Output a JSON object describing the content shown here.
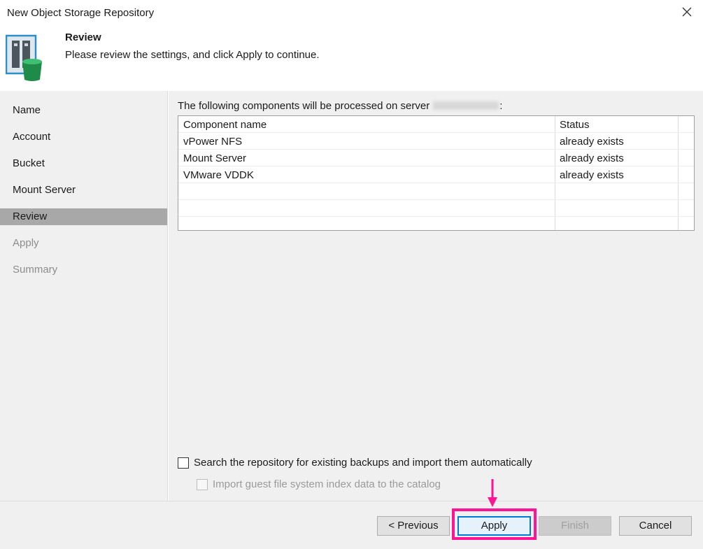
{
  "window": {
    "title": "New Object Storage Repository",
    "close_icon": "close-icon"
  },
  "header": {
    "icon": "object-storage-repository-icon",
    "step_title": "Review",
    "step_description": "Please review the settings, and click Apply to continue."
  },
  "sidebar": {
    "items": [
      {
        "label": "Name",
        "state": "normal"
      },
      {
        "label": "Account",
        "state": "normal"
      },
      {
        "label": "Bucket",
        "state": "normal"
      },
      {
        "label": "Mount Server",
        "state": "normal"
      },
      {
        "label": "Review",
        "state": "active"
      },
      {
        "label": "Apply",
        "state": "disabled"
      },
      {
        "label": "Summary",
        "state": "disabled"
      }
    ]
  },
  "main": {
    "intro_text": "The following components will be processed on server",
    "intro_suffix": ":",
    "table": {
      "columns": [
        "Component name",
        "Status"
      ],
      "rows": [
        [
          "vPower NFS",
          "already exists"
        ],
        [
          "Mount Server",
          "already exists"
        ],
        [
          "VMware VDDK",
          "already exists"
        ]
      ]
    },
    "search_checkbox": {
      "label": "Search the repository for existing backups and import them automatically",
      "checked": false
    },
    "index_checkbox": {
      "label": "Import guest file system index data to the catalog",
      "checked": false,
      "enabled": false
    }
  },
  "footer": {
    "previous_label": "< Previous",
    "apply_label": "Apply",
    "finish_label": "Finish",
    "cancel_label": "Cancel"
  },
  "colors": {
    "annotation": "#ff1493",
    "primary_button_border": "#0078d7",
    "active_nav": "#a8a8a8"
  }
}
